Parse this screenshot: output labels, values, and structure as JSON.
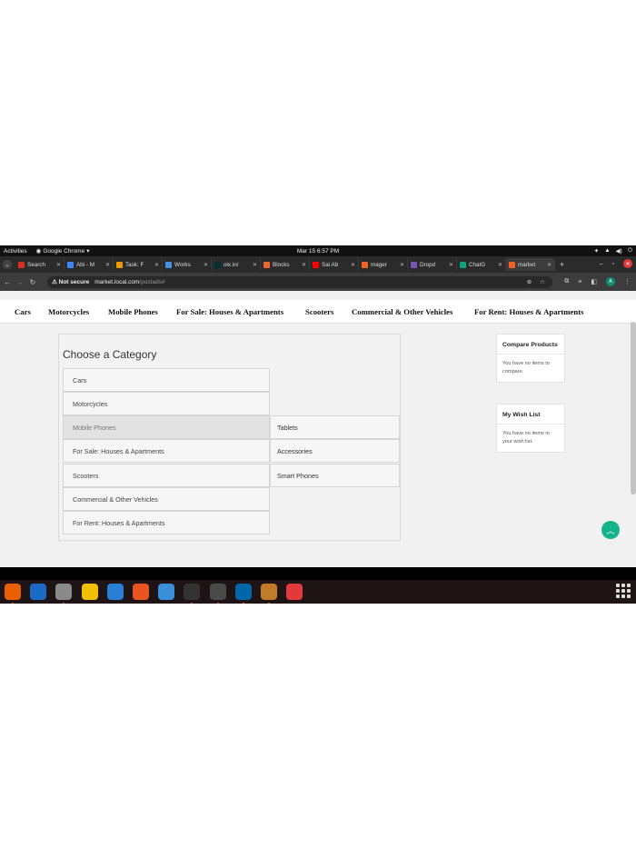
{
  "system": {
    "activities": "Activities",
    "app_name": "Google Chrome",
    "clock": "Mar 15  6:57 PM"
  },
  "tabs": [
    {
      "label": "Search",
      "icon": "gmail-icon",
      "color": "#d93025"
    },
    {
      "label": "Abi - M",
      "icon": "docs-icon",
      "color": "#4285f4"
    },
    {
      "label": "Task: F",
      "icon": "task-icon",
      "color": "#f29900"
    },
    {
      "label": "Works",
      "icon": "workspace-icon",
      "color": "#4a90e2"
    },
    {
      "label": "olx.in/",
      "icon": "olx-icon",
      "color": "#002f34"
    },
    {
      "label": "Blocks",
      "icon": "magento-icon",
      "color": "#ee672f"
    },
    {
      "label": "Sai Ab",
      "icon": "youtube-icon",
      "color": "#ff0000"
    },
    {
      "label": "mager",
      "icon": "magento-icon",
      "color": "#f26322"
    },
    {
      "label": "Dropd",
      "icon": "bootstrap-icon",
      "color": "#7952b3"
    },
    {
      "label": "ChatG",
      "icon": "chatgpt-icon",
      "color": "#10a37f"
    },
    {
      "label": "market",
      "icon": "magento-icon",
      "color": "#f26322",
      "active": true
    }
  ],
  "address": {
    "security": "Not secure",
    "host": "market.local.com",
    "path": "/postads#"
  },
  "site_nav": [
    "Cars",
    "Motorcycles",
    "Mobile Phones",
    "For Sale: Houses & Apartments",
    "Scooters",
    "Commercial & Other Vehicles",
    "For Rent: Houses & Apartments"
  ],
  "category_panel": {
    "title": "Choose a Category",
    "categories": [
      "Cars",
      "Motorcycles",
      "Mobile Phones",
      "For Sale: Houses & Apartments",
      "Scooters",
      "Commercial & Other Vehicles",
      "For Rent: Houses & Apartments"
    ],
    "selected": "Mobile Phones",
    "subcategories": [
      "Tablets",
      "Accessories",
      "Smart Phones"
    ]
  },
  "sidebar": {
    "compare": {
      "title": "Compare Products",
      "body": "You have no items to compare."
    },
    "wishlist": {
      "title": "My Wish List",
      "body": "You have no items in your wish list."
    }
  },
  "dock": [
    {
      "name": "firefox-icon",
      "color": "#e66000",
      "dot": true
    },
    {
      "name": "thunderbird-icon",
      "color": "#1b6ac6",
      "dot": false
    },
    {
      "name": "files-icon",
      "color": "#8a8a8a",
      "dot": true
    },
    {
      "name": "rhythmbox-icon",
      "color": "#f0c000",
      "dot": false
    },
    {
      "name": "writer-icon",
      "color": "#2a7fd4",
      "dot": false
    },
    {
      "name": "software-icon",
      "color": "#e95420",
      "dot": false
    },
    {
      "name": "help-icon",
      "color": "#3b8ed8",
      "dot": false
    },
    {
      "name": "terminal-icon",
      "color": "#333333",
      "dot": true
    },
    {
      "name": "chrome-icon",
      "color": "#4a4a4a",
      "dot": true
    },
    {
      "name": "vscode-icon",
      "color": "#0065a9",
      "dot": true
    },
    {
      "name": "sublime-icon",
      "color": "#c07c2a",
      "dot": true
    },
    {
      "name": "anydesk-icon",
      "color": "#e23a3a",
      "dot": false
    }
  ]
}
